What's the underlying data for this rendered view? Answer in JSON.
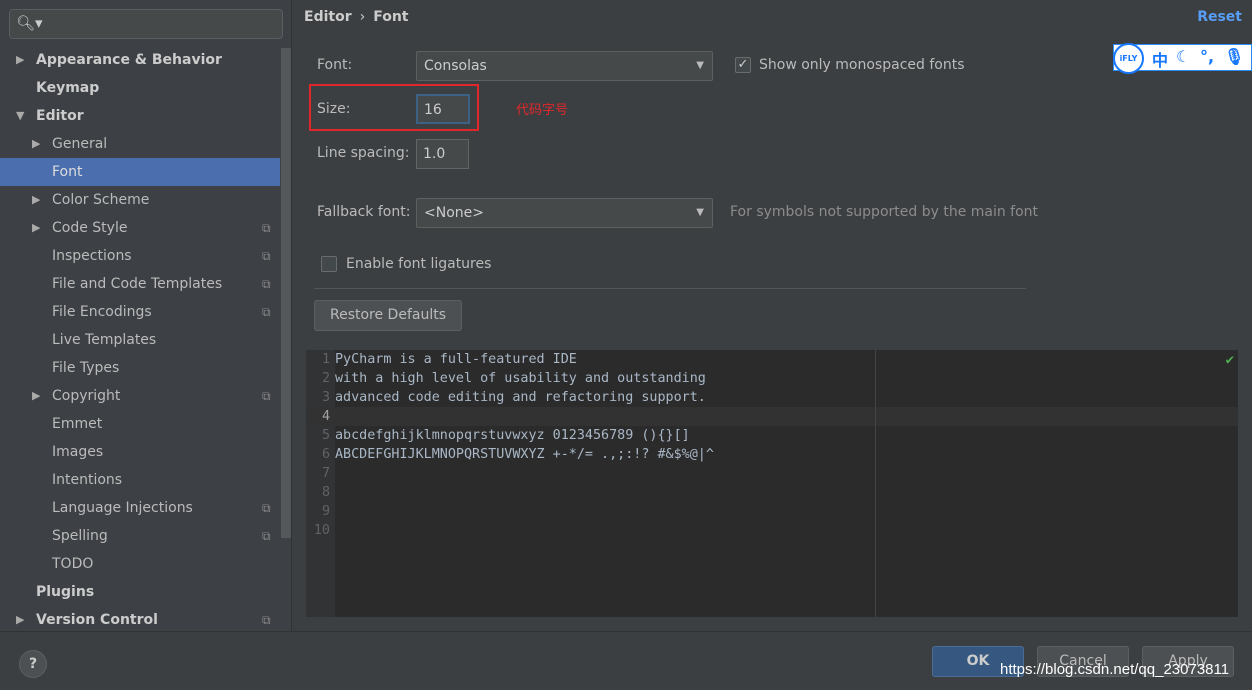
{
  "sidebar": {
    "search_placeholder": "",
    "items": [
      {
        "label": "Appearance & Behavior",
        "level": 0,
        "arrow": "right",
        "bold": true
      },
      {
        "label": "Keymap",
        "level": 0,
        "bold": true
      },
      {
        "label": "Editor",
        "level": 0,
        "arrow": "down",
        "bold": true
      },
      {
        "label": "General",
        "level": 1,
        "arrow": "right"
      },
      {
        "label": "Font",
        "level": 1,
        "selected": true
      },
      {
        "label": "Color Scheme",
        "level": 1,
        "arrow": "right"
      },
      {
        "label": "Code Style",
        "level": 1,
        "arrow": "right",
        "copy": true
      },
      {
        "label": "Inspections",
        "level": 1,
        "copy": true
      },
      {
        "label": "File and Code Templates",
        "level": 1,
        "copy": true
      },
      {
        "label": "File Encodings",
        "level": 1,
        "copy": true
      },
      {
        "label": "Live Templates",
        "level": 1
      },
      {
        "label": "File Types",
        "level": 1
      },
      {
        "label": "Copyright",
        "level": 1,
        "arrow": "right",
        "copy": true
      },
      {
        "label": "Emmet",
        "level": 1
      },
      {
        "label": "Images",
        "level": 1
      },
      {
        "label": "Intentions",
        "level": 1
      },
      {
        "label": "Language Injections",
        "level": 1,
        "copy": true
      },
      {
        "label": "Spelling",
        "level": 1,
        "copy": true
      },
      {
        "label": "TODO",
        "level": 1
      },
      {
        "label": "Plugins",
        "level": 0,
        "bold": true
      },
      {
        "label": "Version Control",
        "level": 0,
        "arrow": "right",
        "bold": true,
        "copy": true
      }
    ]
  },
  "header": {
    "breadcrumb": [
      "Editor",
      "Font"
    ],
    "separator": "›",
    "reset": "Reset"
  },
  "form": {
    "font_label": "Font:",
    "font_value": "Consolas",
    "mono_label": "Show only monospaced fonts",
    "mono_checked": true,
    "size_label": "Size:",
    "size_value": "16",
    "annotation": "代码字号",
    "spacing_label": "Line spacing:",
    "spacing_value": "1.0",
    "fallback_label": "Fallback font:",
    "fallback_value": "<None>",
    "fallback_hint": "For symbols not supported by the main font",
    "ligatures_label": "Enable font ligatures",
    "ligatures_checked": false,
    "restore": "Restore Defaults"
  },
  "preview": {
    "lines": [
      "PyCharm is a full-featured IDE",
      "with a high level of usability and outstanding",
      "advanced code editing and refactoring support.",
      "",
      "abcdefghijklmnopqrstuvwxyz 0123456789 (){}[]",
      "ABCDEFGHIJKLMNOPQRSTUVWXYZ +-*/= .,;:!? #&$%@|^",
      "",
      "",
      "",
      ""
    ],
    "current_line": 4
  },
  "footer": {
    "help": "?",
    "ok": "OK",
    "cancel": "Cancel",
    "apply": "Apply"
  },
  "ime": {
    "logo": "iFLY",
    "lang": "中",
    "icons": [
      "moon-icon",
      "punctuation-icon",
      "microphone-icon"
    ]
  },
  "watermark": "https://blog.csdn.net/qq_23073811",
  "colors": {
    "accent": "#4b6eaf",
    "link": "#589df6",
    "highlight_box": "#e0282c"
  }
}
